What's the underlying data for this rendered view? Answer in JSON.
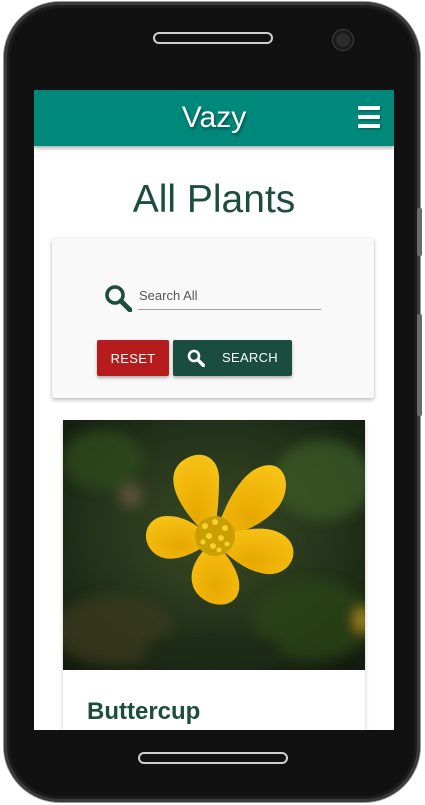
{
  "app": {
    "brand": "Vazy"
  },
  "header": {
    "menu_icon": "hamburger-menu-icon"
  },
  "page": {
    "title": "All Plants"
  },
  "search": {
    "icon": "magnifier-icon",
    "placeholder": "Search All",
    "value": "",
    "reset_label": "RESET",
    "search_label": "SEARCH"
  },
  "plants": [
    {
      "name": "Buttercup",
      "image": "buttercup-flower-photo"
    }
  ],
  "colors": {
    "appbar": "#00897b",
    "title": "#1d4d3c",
    "reset_button": "#b71c1c",
    "search_button": "#1b4d3e"
  }
}
